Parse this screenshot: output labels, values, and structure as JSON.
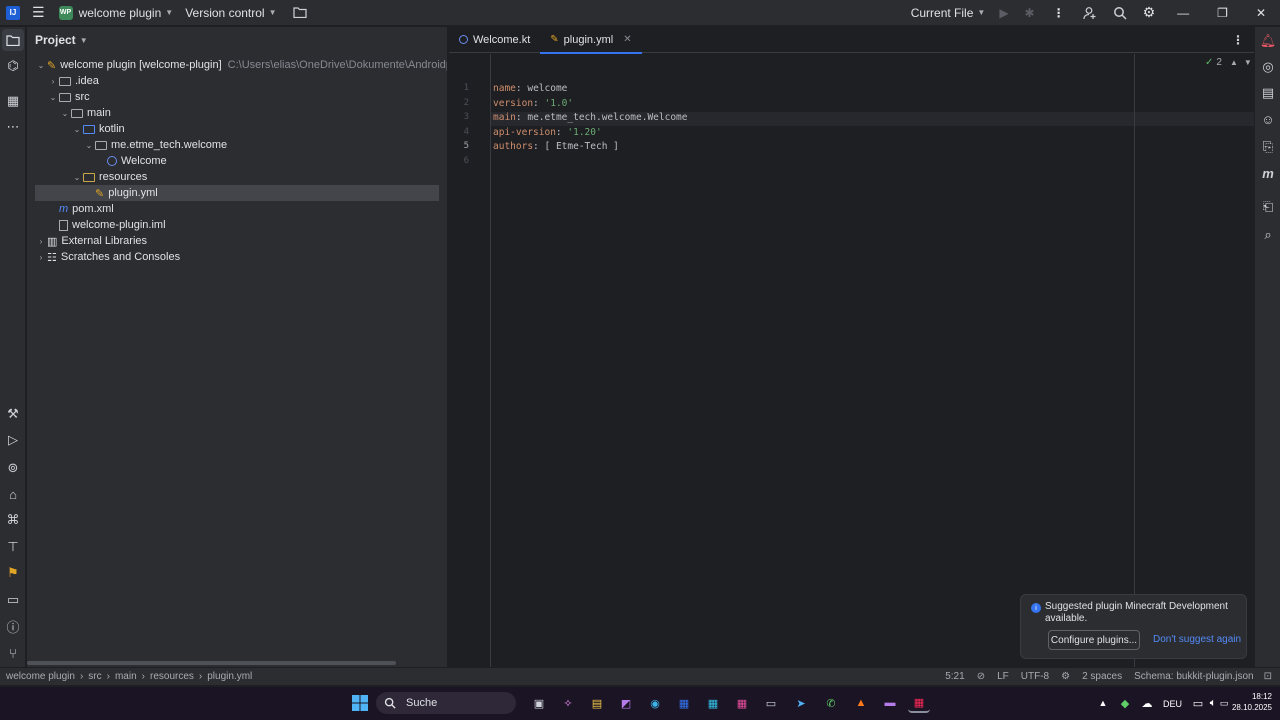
{
  "titlebar": {
    "project_badge": "WP",
    "project_name": "welcome plugin",
    "vcs": "Version control",
    "run_config": "Current File"
  },
  "project_panel": {
    "title": "Project",
    "tree": [
      {
        "label": "welcome plugin [welcome-plugin]",
        "extra": "C:\\Users\\elias\\OneDrive\\Dokumente\\Androidprojekte\\wel",
        "depth": 0,
        "expanded": true
      },
      {
        "label": ".idea",
        "depth": 1,
        "expanded": false
      },
      {
        "label": "src",
        "depth": 1,
        "expanded": true
      },
      {
        "label": "main",
        "depth": 2,
        "expanded": true
      },
      {
        "label": "kotlin",
        "depth": 3,
        "expanded": true
      },
      {
        "label": "me.etme_tech.welcome",
        "depth": 4,
        "expanded": true
      },
      {
        "label": "Welcome",
        "depth": 5
      },
      {
        "label": "resources",
        "depth": 3,
        "expanded": true
      },
      {
        "label": "plugin.yml",
        "depth": 4,
        "selected": true
      },
      {
        "label": "pom.xml",
        "depth": 1
      },
      {
        "label": "welcome-plugin.iml",
        "depth": 1
      },
      {
        "label": "External Libraries",
        "depth": 0,
        "expanded": false
      },
      {
        "label": "Scratches and Consoles",
        "depth": 0,
        "expanded": false
      }
    ]
  },
  "editor": {
    "tabs": [
      {
        "label": "Welcome.kt",
        "active": false
      },
      {
        "label": "plugin.yml",
        "active": true
      }
    ],
    "problems_count": "2",
    "lines": [
      {
        "num": "1",
        "key": "name",
        "value": "welcome"
      },
      {
        "num": "2",
        "key": "version",
        "value": "'1.0'"
      },
      {
        "num": "3",
        "key": "main",
        "value": "me.etme_tech.welcome.Welcome"
      },
      {
        "num": "4",
        "key": "api-version",
        "value": "'1.20'"
      },
      {
        "num": "5",
        "key": "authors",
        "value": "[ Etme-Tech ]"
      },
      {
        "num": "6",
        "key": "",
        "value": ""
      }
    ]
  },
  "notification": {
    "message": "Suggested plugin Minecraft Development available.",
    "primary_action": "Configure plugins...",
    "secondary_action": "Don't suggest again"
  },
  "statusbar": {
    "breadcrumb": [
      "welcome plugin",
      "src",
      "main",
      "resources",
      "plugin.yml"
    ],
    "position": "5:21",
    "line_sep": "LF",
    "encoding": "UTF-8",
    "indent": "2 spaces",
    "schema": "Schema: bukkit-plugin.json"
  },
  "taskbar": {
    "search": "Suche",
    "lang": "DEU",
    "time": "18:12",
    "date": "28.10.2025"
  }
}
